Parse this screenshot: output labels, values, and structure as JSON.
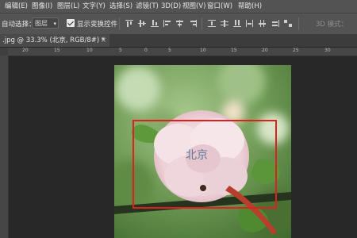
{
  "menubar": {
    "items": [
      "编辑(E)",
      "图像(I)",
      "图层(L)",
      "文字(Y)",
      "选择(S)",
      "滤镜(T)",
      "3D(D)",
      "视图(V)",
      "窗口(W)",
      "帮助(H)"
    ]
  },
  "options": {
    "auto_select_label": "自动选择：",
    "auto_select_value": "图层",
    "show_transform_label": "显示变换控件",
    "mode_label": "3D 模式："
  },
  "document": {
    "tab_title": ".jpg @ 33.3% (北京, RGB/8#) *",
    "close_glyph": "×"
  },
  "ruler": {
    "ticks": [
      "20",
      "15",
      "10",
      "5",
      "0",
      "5",
      "10",
      "15",
      "20",
      "25",
      "30"
    ]
  },
  "canvas": {
    "text_layer": "北京"
  },
  "colors": {
    "selection": "#e0201e",
    "chrome": "#535353",
    "workspace": "#282828"
  }
}
